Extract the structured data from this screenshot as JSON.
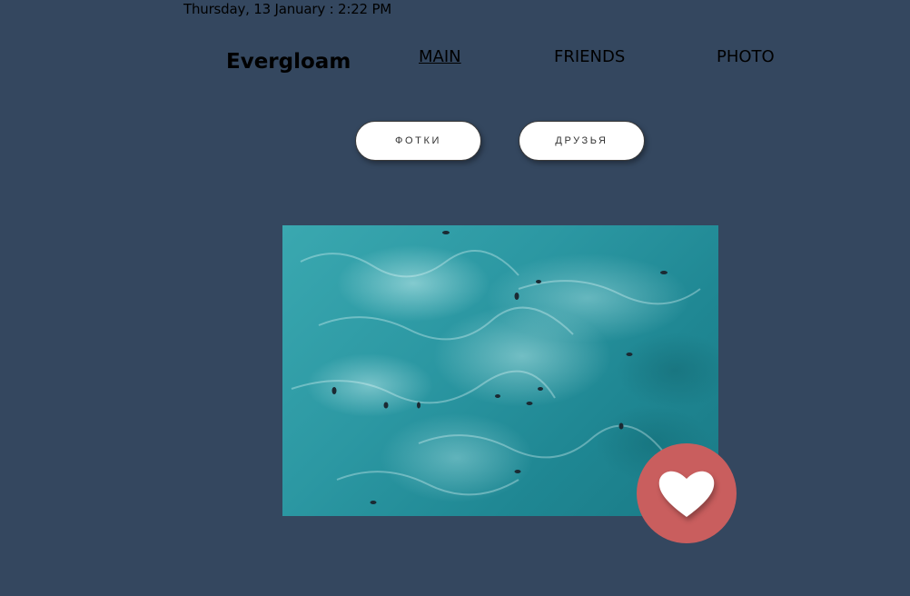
{
  "header": {
    "datetime": "Thursday, 13 January : 2:22 PM",
    "brand": "Evergloam"
  },
  "nav": {
    "items": [
      {
        "label": "MAIN",
        "active": true
      },
      {
        "label": "FRIENDS",
        "active": false
      },
      {
        "label": "PHOTO",
        "active": false
      }
    ]
  },
  "actions": {
    "photos_label": "ФОТКИ",
    "friends_label": "ДРУЗЬЯ"
  },
  "content": {
    "photo_subject": "aerial ocean surf",
    "like_icon": "heart-icon"
  },
  "colors": {
    "background": "#34475f",
    "like_button": "#c95e5e",
    "pill_background": "#ffffff"
  }
}
